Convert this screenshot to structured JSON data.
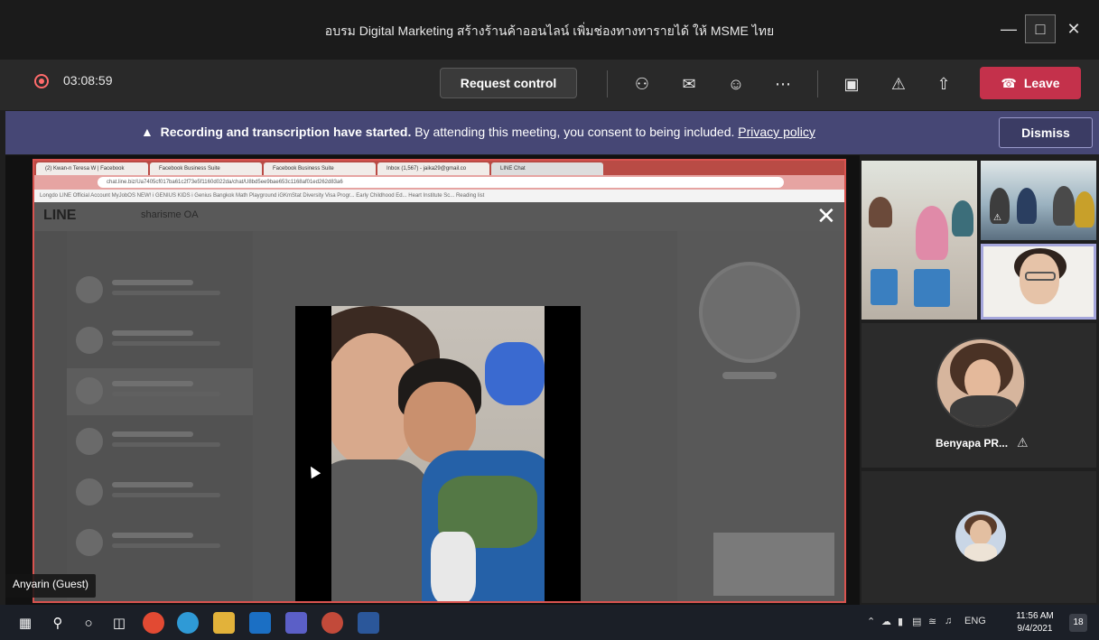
{
  "window": {
    "title": "อบรม Digital Marketing สร้างร้านค้าออนไลน์ เพิ่มช่องทางทารายได้ ให้ MSME ไทย",
    "min_icon": "minimize-icon",
    "max_icon": "maximize-icon",
    "close_icon": "close-icon"
  },
  "toolbar": {
    "recording_time": "03:08:59",
    "request_control_label": "Request control",
    "leave_label": "Leave",
    "icons": [
      "participants-icon",
      "chat-icon",
      "reactions-icon",
      "more-icon",
      "camera-off-icon",
      "mic-off-icon",
      "share-icon"
    ],
    "leave_color": "#c4314b"
  },
  "banner": {
    "bold_text": "Recording and transcription have started.",
    "text": "By attending this meeting, you consent to being included.",
    "link_text": "Privacy policy",
    "dismiss_label": "Dismiss",
    "color": "#464775"
  },
  "shared_screen": {
    "browser_tabs": [
      "(2) Kwan-n Teresa W | Facebook",
      "Facebook Business Suite",
      "Facebook Business Suite",
      "Inbox (1,567) - jaika29@gmail.co",
      "LINE Chat"
    ],
    "url": "chat.line.biz/Ua7405cf017ba61c2f73e5f1160d022da/chat/U8bd5ee9bae653c1168af01ed262d83a6",
    "bookmarks": "Longdo  LINE Official Account  MyJobOS  NEW! i GENIUS KIDS  i Genius Bangkok  Math Playground  iGKmStat  Diversity Visa Progr...  Early Childhood Ed...  Heart Institute  Sc...   Reading list",
    "line_logo": "LINE",
    "line_account": "sharisme OA",
    "presenter_label": "Anyarin (Guest)"
  },
  "gallery": {
    "participant_name": "Benyapa PR..."
  },
  "taskbar": {
    "apps": [
      "start-icon",
      "search-icon",
      "cortana-icon",
      "task-view-icon",
      "chrome-icon",
      "edge-icon",
      "file-explorer-icon",
      "outlook-icon",
      "teams-icon",
      "chrome-alt-icon",
      "word-icon"
    ],
    "language": "ENG",
    "time": "11:56 AM",
    "date": "9/4/2021",
    "notification_count": "18"
  }
}
